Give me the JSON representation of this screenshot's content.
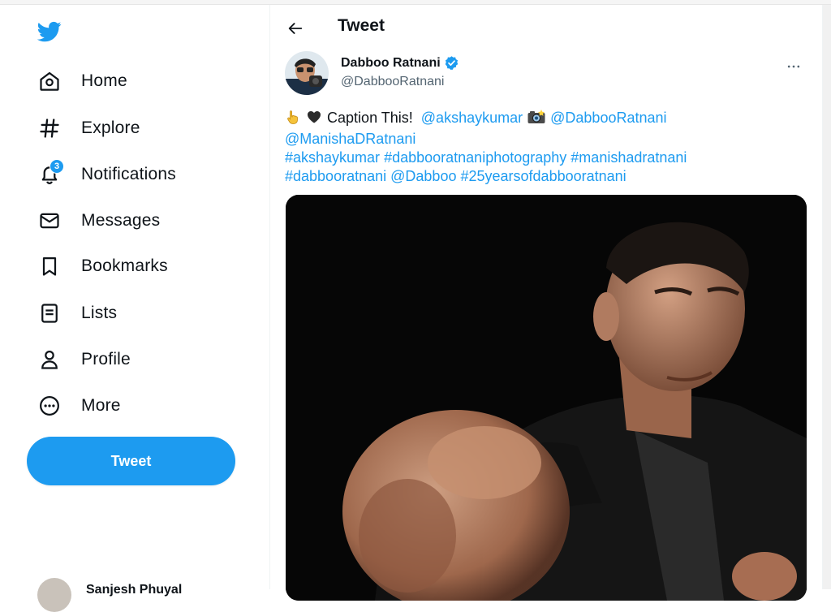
{
  "sidebar": {
    "nav": [
      {
        "label": "Home",
        "icon": "home-icon"
      },
      {
        "label": "Explore",
        "icon": "hashtag-icon"
      },
      {
        "label": "Notifications",
        "icon": "bell-icon",
        "badge": "3"
      },
      {
        "label": "Messages",
        "icon": "envelope-icon"
      },
      {
        "label": "Bookmarks",
        "icon": "bookmark-icon"
      },
      {
        "label": "Lists",
        "icon": "list-icon"
      },
      {
        "label": "Profile",
        "icon": "person-icon"
      },
      {
        "label": "More",
        "icon": "more-circle-icon"
      }
    ],
    "tweet_button": "Tweet",
    "account_name": "Sanjesh Phuyal"
  },
  "header": {
    "title": "Tweet"
  },
  "tweet": {
    "display_name": "Dabboo Ratnani",
    "handle": "@DabbooRatnani",
    "text_prefix": "Caption This!",
    "mention_1": "@akshaykumar",
    "mention_2": "@DabbooRatnani",
    "mention_3": "@ManishaDRatnani",
    "hashtag_1": "#akshaykumar",
    "hashtag_2": "#dabbooratnaniphotography",
    "hashtag_3": "#manishadratnani",
    "hashtag_4": "#dabbooratnani",
    "mention_4": "@Dabboo",
    "hashtag_5": "#25yearsofdabbooratnani"
  },
  "colors": {
    "accent": "#1d9bf0",
    "text": "#0f1419",
    "muted": "#536471"
  }
}
